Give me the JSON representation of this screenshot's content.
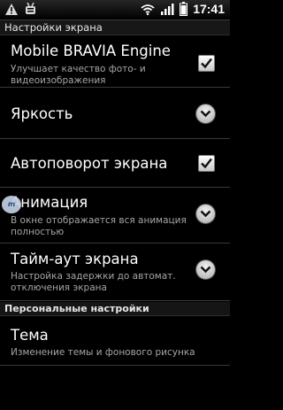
{
  "status_bar": {
    "time": "17:41",
    "left_icons": [
      "warning-icon",
      "usb-debug-icon"
    ],
    "right_icons": [
      "wifi-icon",
      "signal-icon",
      "battery-icon"
    ]
  },
  "header": {
    "title": "Настройки экрана"
  },
  "items": [
    {
      "title": "Mobile BRAVIA Engine",
      "summary": "Улучшает качество фото- и видеоизображения",
      "control": "checkbox",
      "checked": true
    },
    {
      "title": "Яркость",
      "summary": "",
      "control": "dropdown"
    },
    {
      "title": "Автоповорот экрана",
      "summary": "",
      "control": "checkbox",
      "checked": true
    },
    {
      "title": "Анимация",
      "summary": "В окне отображается вся анимация полностью",
      "control": "dropdown"
    },
    {
      "title": "Тайм-аут экрана",
      "summary": "Настройка задержки до автомат. отключения экрана",
      "control": "dropdown"
    }
  ],
  "section": {
    "title": "Персональные настройки"
  },
  "personal_items": [
    {
      "title": "Тема",
      "summary": "Изменение темы и фонового рисунка"
    }
  ],
  "watermark": {
    "text": "m"
  }
}
